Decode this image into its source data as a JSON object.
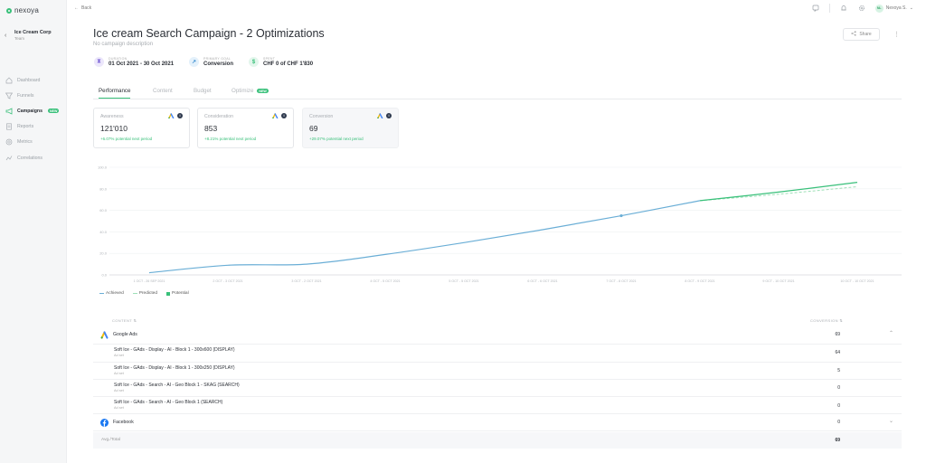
{
  "app": {
    "logo_text": "nexoya"
  },
  "org": {
    "name": "Ice Cream Corp",
    "sub": "Team"
  },
  "nav": [
    {
      "label": "Dashboard",
      "icon": "home-icon"
    },
    {
      "label": "Funnels",
      "icon": "funnel-icon"
    },
    {
      "label": "Campaigns",
      "icon": "megaphone-icon",
      "badge": "NEW",
      "active": true
    },
    {
      "label": "Reports",
      "icon": "report-icon"
    },
    {
      "label": "Metrics",
      "icon": "metrics-icon"
    },
    {
      "label": "Correlations",
      "icon": "correlation-icon"
    }
  ],
  "topbar": {
    "back_label": "Back",
    "user_initials": "NL",
    "user_name": "Nexoya S."
  },
  "header": {
    "title": "Ice cream Search Campaign - 2 Optimizations",
    "description": "No campaign description",
    "share_label": "Share"
  },
  "meta": {
    "duration": {
      "label": "DURATION",
      "value": "01 Oct 2021 - 30 Oct 2021"
    },
    "goal": {
      "label": "PRIMARY GOAL",
      "value": "Conversion"
    },
    "spent": {
      "label": "SPENT",
      "value": "CHF 0 of CHF 1'830"
    }
  },
  "tabs": [
    {
      "label": "Performance",
      "active": true
    },
    {
      "label": "Content"
    },
    {
      "label": "Budget"
    },
    {
      "label": "Optimize",
      "badge": "NEW"
    }
  ],
  "cards": [
    {
      "label": "Awareness",
      "value": "121'010",
      "delta": "+6.07% potential next period"
    },
    {
      "label": "Consideration",
      "value": "853",
      "delta": "+8.21% potential next period"
    },
    {
      "label": "Conversion",
      "value": "69",
      "delta": "+29.07% potential next period"
    }
  ],
  "chart_data": {
    "type": "line",
    "x": [
      "1 OCT - 26 SEP 2021",
      "2 OCT - 3 OCT 2021",
      "3 OCT - 2 OCT 2021",
      "4 OCT - 5 OCT 2021",
      "5 OCT - 5 OCT 2021",
      "6 OCT - 6 OCT 2021",
      "7 OCT - 8 OCT 2021",
      "8 OCT - 9 OCT 2021",
      "9 OCT - 10 OCT 2021",
      "10 OCT - 10 OCT 2021"
    ],
    "y_ticks": [
      "100.0",
      "80.0",
      "60.0",
      "40.0",
      "20.0",
      "0.0"
    ],
    "ylim": [
      0,
      100
    ],
    "series": [
      {
        "name": "Achieved",
        "color": "#6aaed6",
        "values": [
          2,
          9,
          10,
          19,
          30,
          42,
          55,
          69,
          null,
          null
        ]
      },
      {
        "name": "Predicted",
        "color": "#9fe0b8",
        "values": [
          null,
          null,
          null,
          null,
          null,
          null,
          null,
          69,
          75,
          82
        ]
      },
      {
        "name": "Potential",
        "color": "#39c07a",
        "values": [
          null,
          null,
          null,
          null,
          null,
          null,
          null,
          69,
          77,
          86
        ]
      }
    ],
    "legend": [
      "Achieved",
      "Predicted",
      "Potential"
    ],
    "grid": true
  },
  "table": {
    "col_content": "CONTENT",
    "col_conversion": "CONVERSION",
    "groups": [
      {
        "name": "Google Ads",
        "icon": "google-ads-icon",
        "value": "69",
        "rows": [
          {
            "name": "Soft Ice - GAds - Display - AI - Block 1 - 300x600 (DISPLAY)",
            "sub": "Ad set",
            "value": "64"
          },
          {
            "name": "Soft Ice - GAds - Display - AI - Block 1 - 300x250 (DISPLAY)",
            "sub": "Ad set",
            "value": "5"
          },
          {
            "name": "Soft Ice - GAds - Search - AI - Geo Block 1 - SKAG (SEARCH)",
            "sub": "Ad set",
            "value": "0"
          },
          {
            "name": "Soft Ice - GAds - Search - AI - Geo Block 1 (SEARCH)",
            "sub": "Ad set",
            "value": "0"
          }
        ]
      },
      {
        "name": "Facebook",
        "icon": "facebook-icon",
        "value": "0"
      }
    ],
    "footer_label": "Avg./Total",
    "footer_value": "69"
  },
  "colors": {
    "accent": "#39c07a",
    "achieved": "#6aaed6"
  }
}
